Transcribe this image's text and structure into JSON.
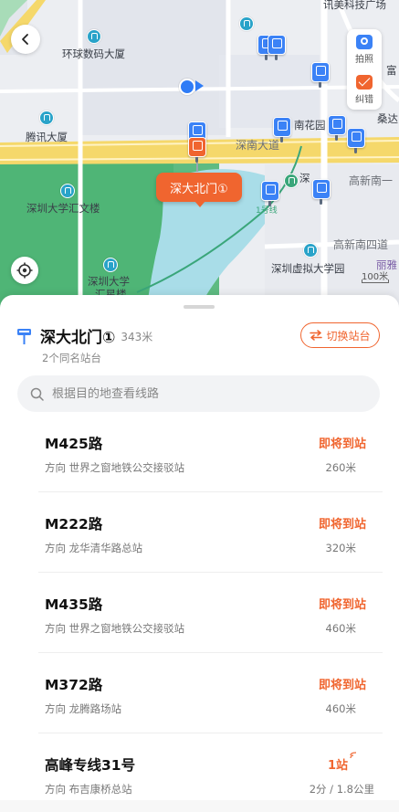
{
  "map": {
    "labels": {
      "xunmei": "讯美科技广场",
      "huanqiu": "环球数码大厦",
      "fu": "富",
      "tengxun": "腾讯大厦",
      "nanhuayuan": "南花园",
      "sangda": "桑达",
      "shennan": "深南大道",
      "shen": "深",
      "gaoxin_nanyi": "高新南一",
      "szu_huiwen": "深圳大学汇文楼",
      "szu_1": "深圳大学",
      "szu_2": "汇星楼",
      "line1": "1号线",
      "gaoxin_nansi": "高新南四道",
      "xuni": "深圳虚拟大学园",
      "liya": "丽雅"
    },
    "selected_stop_bubble": "深大北门①",
    "scale_text": "100米",
    "tools": {
      "photo": "拍照",
      "correct": "纠错"
    }
  },
  "stop": {
    "name": "深大北门①",
    "distance": "343米",
    "same_name_count": "2个同名站台",
    "switch_label": "切换站台"
  },
  "search": {
    "placeholder": "根据目的地查看线路"
  },
  "routes": [
    {
      "name": "M425路",
      "direction": "方向 世界之窗地铁公交接驳站",
      "status": "即将到站",
      "distance": "260米"
    },
    {
      "name": "M222路",
      "direction": "方向 龙华清华路总站",
      "status": "即将到站",
      "distance": "320米"
    },
    {
      "name": "M435路",
      "direction": "方向 世界之窗地铁公交接驳站",
      "status": "即将到站",
      "distance": "460米"
    },
    {
      "name": "M372路",
      "direction": "方向 龙腾路场站",
      "status": "即将到站",
      "distance": "460米"
    },
    {
      "name": "高峰专线31号",
      "direction": "方向 布吉康桥总站",
      "status": "1站",
      "distance": "2分 / 1.8公里"
    }
  ],
  "colors": {
    "accent": "#f0652f",
    "bus_blue": "#3b82f6",
    "metro_green": "#3aa67a"
  }
}
